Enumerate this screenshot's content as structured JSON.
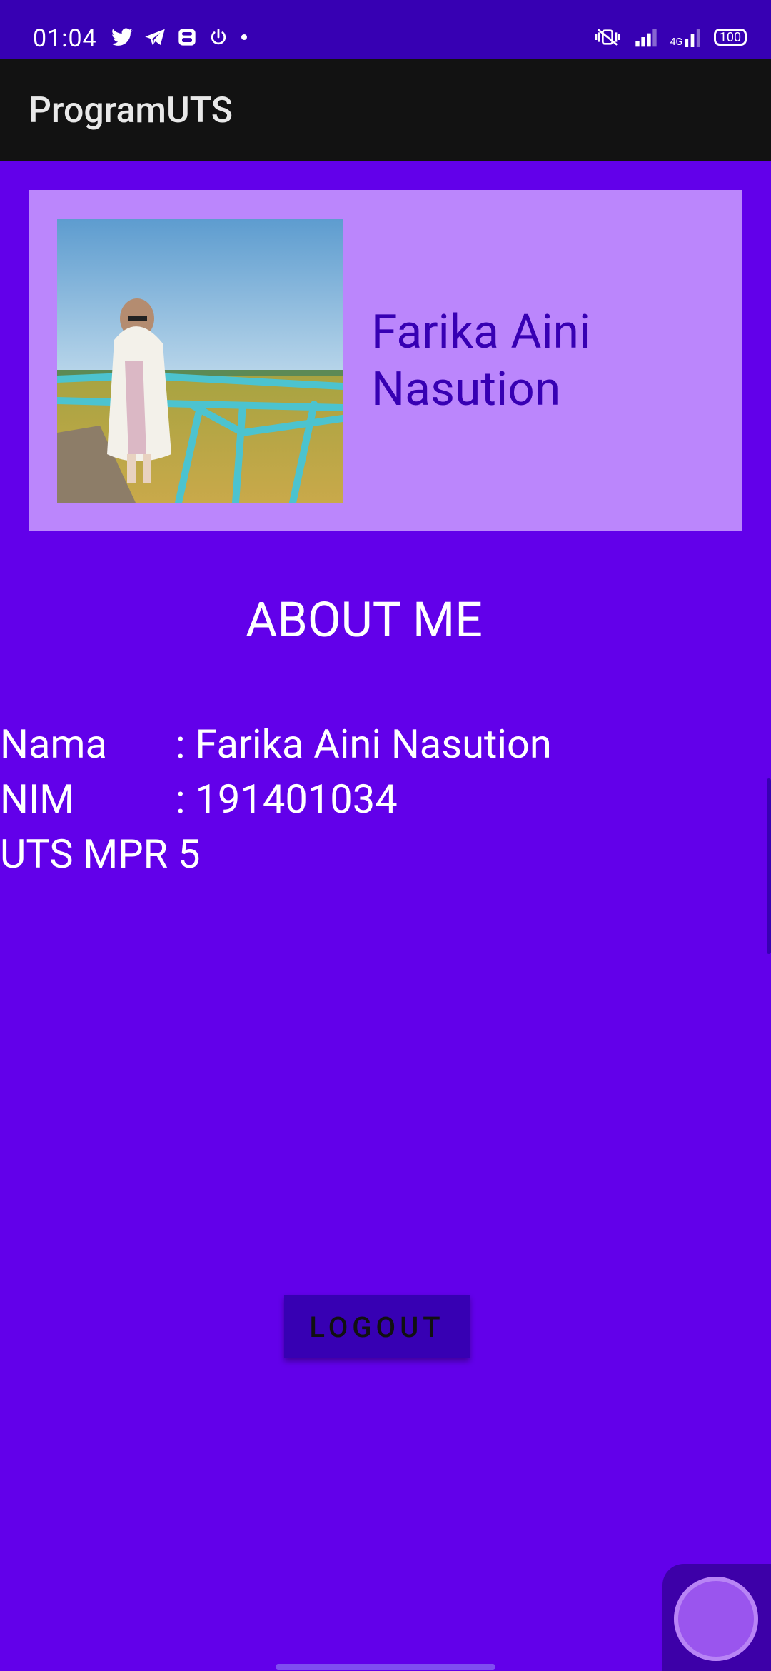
{
  "status_bar": {
    "time": "01:04",
    "left_icons": [
      "twitter-icon",
      "telegram-icon",
      "app-icon",
      "power-icon",
      "dot-icon"
    ],
    "right_icons": [
      "vibrate-silent-icon",
      "signal-icon",
      "4g-signal-icon"
    ],
    "network_label": "4G",
    "battery": "100"
  },
  "app_bar": {
    "title": "ProgramUTS"
  },
  "profile": {
    "name": "Farika Aini Nasution",
    "photo": "profile-photo"
  },
  "about": {
    "title": "ABOUT ME",
    "rows": [
      {
        "label": "Nama",
        "value": ": Farika Aini Nasution"
      },
      {
        "label": "NIM",
        "value": ": 191401034"
      }
    ],
    "extra": "UTS MPR 5"
  },
  "logout_label": "LOGOUT",
  "colors": {
    "background": "#6200EA",
    "status_bar": "#3700B3",
    "app_bar": "#121212",
    "card": "#BB86FC",
    "name_text": "#3700B3",
    "button": "#3700B3"
  }
}
